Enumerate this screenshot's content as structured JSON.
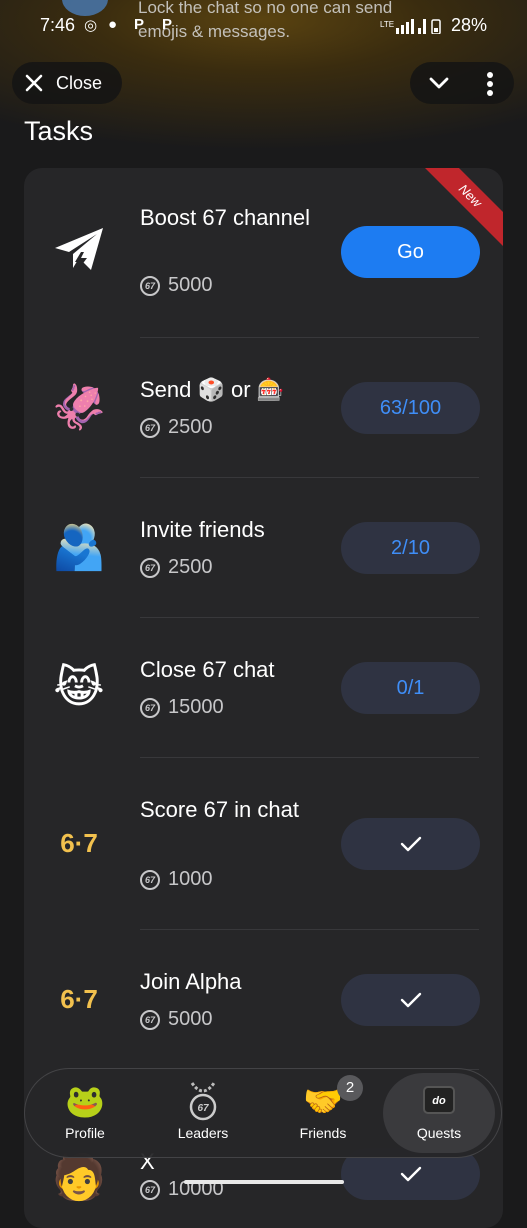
{
  "status_bar": {
    "time": "7:46",
    "battery": "28%",
    "notification_text": "Lock the chat so no one can send emojis & messages."
  },
  "header": {
    "close_label": "Close",
    "title": "Tasks"
  },
  "ribbon_label": "New",
  "tasks": [
    {
      "name": "Boost 67 channel",
      "reward": "5000",
      "button": "Go",
      "state": "go",
      "icon": "telegram-boost-icon"
    },
    {
      "name": "Send 🎲 or 🎰",
      "reward": "2500",
      "button": "63/100",
      "state": "progress",
      "icon": "squid-laptop-icon"
    },
    {
      "name": "Invite friends",
      "reward": "2500",
      "button": "2/10",
      "state": "progress",
      "icon": "friends-hug-icon"
    },
    {
      "name": "Close 67 chat",
      "reward": "15000",
      "button": "0/1",
      "state": "progress",
      "icon": "crying-cat-icon"
    },
    {
      "name": "Score 67 in chat",
      "reward": "1000",
      "button": "",
      "state": "done",
      "icon": "six-seven-hands-icon"
    },
    {
      "name": "Join Alpha",
      "reward": "5000",
      "button": "",
      "state": "done",
      "icon": "six-seven-hands-icon"
    },
    {
      "name": "X",
      "reward": "10000",
      "button": "",
      "state": "done",
      "icon": "x-avatar-icon"
    }
  ],
  "coin_label": "67",
  "nav": {
    "items": [
      {
        "label": "Profile",
        "icon": "frog-crown-icon"
      },
      {
        "label": "Leaders",
        "icon": "chain-medal-icon"
      },
      {
        "label": "Friends",
        "icon": "handshake-icon",
        "badge": "2"
      },
      {
        "label": "Quests",
        "icon": "keycap-icon"
      }
    ],
    "active": "Quests"
  }
}
